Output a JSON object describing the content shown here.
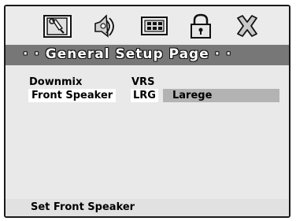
{
  "icon_bar": {
    "icons": [
      {
        "name": "general-setup-icon",
        "selected": true
      },
      {
        "name": "audio-setup-icon"
      },
      {
        "name": "video-setup-icon"
      },
      {
        "name": "password-lock-icon"
      },
      {
        "name": "exit-icon"
      }
    ]
  },
  "header": {
    "title": "· · General Setup Page · ·"
  },
  "menu": {
    "rows": [
      {
        "label": "Downmix",
        "value": "VRS"
      },
      {
        "label": "Front Speaker",
        "value": "LRG",
        "selected": true,
        "option": "Larege"
      }
    ]
  },
  "footer": {
    "status": "Set Front Speaker"
  },
  "colors": {
    "panel_bg": "#e9e9e9",
    "header_bg": "#777777",
    "option_bg": "#b3b3b3",
    "selection_bg": "#ffffff"
  }
}
